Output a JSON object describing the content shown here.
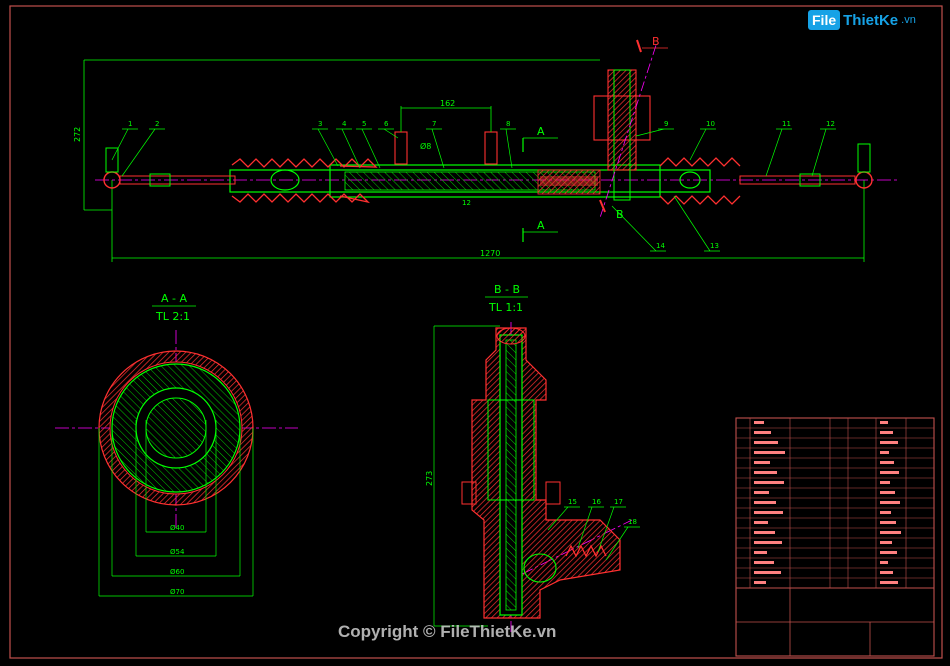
{
  "logo": {
    "badge": "File",
    "text": "ThietKe",
    "suffix": ".vn"
  },
  "copyright": "Copyright © FileThietKe.vn",
  "main_view": {
    "dim_overall": "1270",
    "dim_height": "272",
    "dim_top": "162",
    "dim_diameter": "Ø8",
    "dim_small": "12",
    "section_a": "A",
    "section_b": "B",
    "part_numbers": [
      "1",
      "2",
      "3",
      "4",
      "5",
      "6",
      "7",
      "8",
      "9",
      "10",
      "11",
      "12",
      "13",
      "14"
    ]
  },
  "section_aa": {
    "title": "A - A",
    "scale": "TL 2:1",
    "dims": [
      "Ø40",
      "Ø54",
      "Ø60",
      "Ø70"
    ]
  },
  "section_bb": {
    "title": "B - B",
    "scale": "TL 1:1",
    "dim_height": "273",
    "part_numbers": [
      "15",
      "16",
      "17",
      "18"
    ]
  },
  "colors": {
    "outline": "#00ff00",
    "hatch": "#ff3030",
    "dim": "#00ff00",
    "centerline": "#ff00ff",
    "border": "#c0504d",
    "part": "#ffd700"
  }
}
